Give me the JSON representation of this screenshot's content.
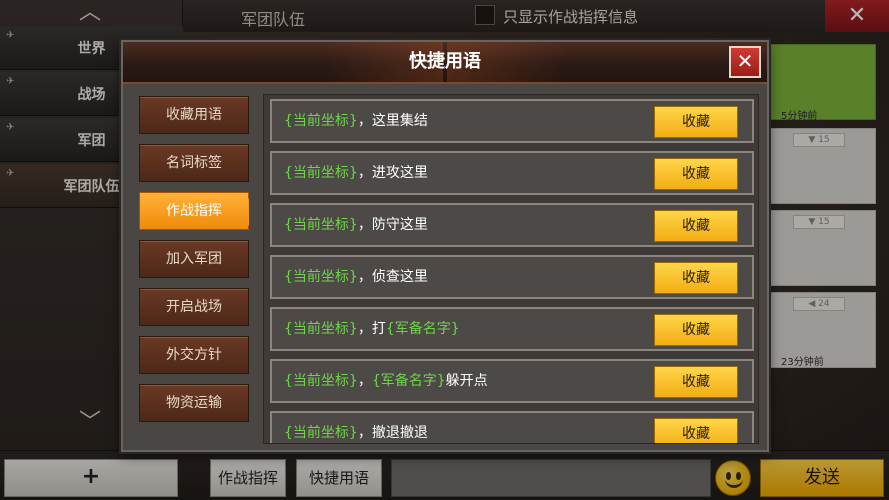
{
  "sidebar": {
    "tabs": [
      {
        "label": "世界"
      },
      {
        "label": "战场"
      },
      {
        "label": "军团"
      },
      {
        "label": "军团队伍"
      }
    ]
  },
  "top_bar": {
    "title": "军团队伍",
    "filter_label": "只显示作战指挥信息"
  },
  "right_cards": {
    "card1_time": "5分钟前",
    "card2_tag": "15",
    "card3_tag": "15",
    "card4_tag": "24",
    "card4_time": "23分钟前"
  },
  "modal": {
    "title": "快捷用语",
    "categories": [
      {
        "label": "收藏用语"
      },
      {
        "label": "名词标签"
      },
      {
        "label": "作战指挥"
      },
      {
        "label": "加入军团"
      },
      {
        "label": "开启战场"
      },
      {
        "label": "外交方针"
      },
      {
        "label": "物资运输"
      }
    ],
    "active_category": "作战指挥",
    "fav_label": "收藏",
    "placeholders": {
      "coord": "{当前坐标}",
      "unit": "{军备名字}"
    },
    "phrases": [
      {
        "pre": "，这里集结"
      },
      {
        "pre": "，进攻这里"
      },
      {
        "pre": "，防守这里"
      },
      {
        "pre": "，侦查这里"
      },
      {
        "pre": "，打",
        "post": ""
      },
      {
        "pre": "，",
        "post": "躲开点"
      },
      {
        "pre": "，撤退撤退"
      }
    ]
  },
  "bottom_bar": {
    "plus_label": "+",
    "tab_command": "作战指挥",
    "tab_quick": "快捷用语",
    "send_label": "发送"
  }
}
